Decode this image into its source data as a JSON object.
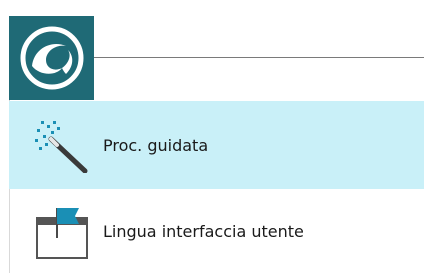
{
  "app_button": {
    "icon": "wave-logo-icon",
    "color": "#1f6a76"
  },
  "menu": {
    "items": [
      {
        "label": "Proc. guidata",
        "icon": "magic-wand-icon",
        "highlighted": true
      },
      {
        "label": "Lingua interfaccia utente",
        "icon": "language-flag-window-icon",
        "highlighted": false
      }
    ]
  },
  "colors": {
    "highlight": "#c9f0f8",
    "brand": "#1f6a76",
    "flag": "#1a8fb5"
  }
}
